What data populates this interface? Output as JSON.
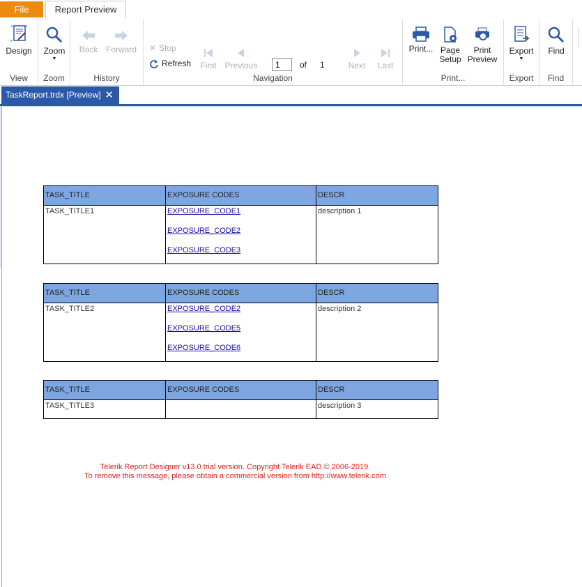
{
  "tabs": {
    "file": "File",
    "report_preview": "Report Preview"
  },
  "ribbon": {
    "view": {
      "label": "View",
      "design": "Design"
    },
    "zoom": {
      "label": "Zoom",
      "zoom": "Zoom"
    },
    "history": {
      "label": "History",
      "back": "Back",
      "forward": "Forward"
    },
    "navigation": {
      "label": "Navigation",
      "stop": "Stop",
      "refresh": "Refresh",
      "first": "First",
      "previous": "Previous",
      "page_value": "1",
      "of": "of",
      "total_pages": "1",
      "next": "Next",
      "last": "Last"
    },
    "print": {
      "label": "Print...",
      "print": "Print...",
      "page_setup_1": "Page",
      "page_setup_2": "Setup",
      "print_preview_1": "Print",
      "print_preview_2": "Preview"
    },
    "export": {
      "label": "Export",
      "export": "Export"
    },
    "find": {
      "label": "Find",
      "find": "Find"
    }
  },
  "document_tab": {
    "title": "TaskReport.trdx [Preview]",
    "close": "✕"
  },
  "report": {
    "headers": [
      "TASK_TITLE",
      "EXPOSURE CODES",
      "DESCR"
    ],
    "rows": [
      {
        "title": "TASK_TITLE1",
        "codes": [
          "EXPOSURE_CODE1",
          "EXPOSURE_CODE2",
          "EXPOSURE_CODE3"
        ],
        "descr": "description 1"
      },
      {
        "title": "TASK_TITLE2",
        "codes": [
          "EXPOSURE_CODE2",
          "EXPOSURE_CODE5",
          "EXPOSURE_CODE6"
        ],
        "descr": "description 2"
      },
      {
        "title": "TASK_TITLE3",
        "codes": [],
        "descr": "description 3"
      }
    ]
  },
  "trial_notice": {
    "line1": "Telerik Report Designer v13.0 trial version. Copyright Telerik EAD © 2006-2019.",
    "line2": "To remove this message, please obtain a commercial version from http://www.telerik.com"
  },
  "colors": {
    "file_tab": "#ef8a11",
    "doc_tab": "#2c59a7",
    "table_header": "#7ea6e0",
    "trial_text": "#e0201c",
    "link": "#1a0dab"
  }
}
